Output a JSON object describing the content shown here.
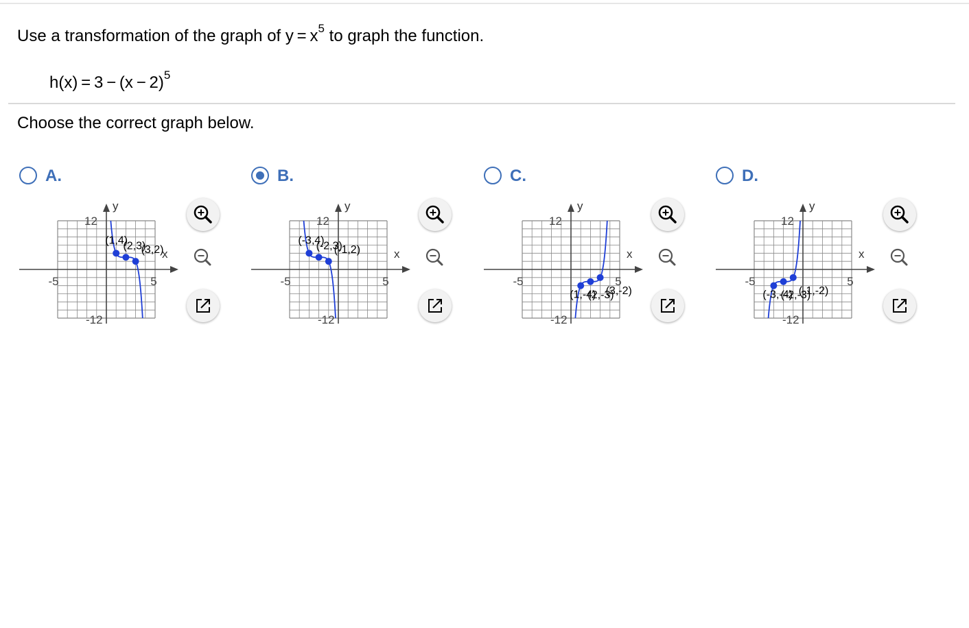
{
  "question": {
    "prefix": "Use a transformation of the graph of y = x",
    "exponent": "5",
    "suffix": " to graph the function."
  },
  "function": {
    "base": "h(x) = 3 − (x − 2)",
    "exponent": "5"
  },
  "instruction": "Choose the correct graph below.",
  "selected_option": "B",
  "colors": {
    "accent": "#3e6fb8",
    "curve": "#1f3fd6",
    "grid": "#888888"
  },
  "tools": [
    "zoom-in-icon",
    "zoom-out-icon",
    "open-in-new-window-icon"
  ],
  "chart_data": [
    {
      "type": "line",
      "option": "A.",
      "selected": false,
      "xlabel": "x",
      "ylabel": "y",
      "xlim": [
        -5,
        5
      ],
      "ylim": [
        -12,
        12
      ],
      "x_ticks": [
        "-5",
        "5"
      ],
      "y_ticks": [
        "12",
        "-12"
      ],
      "grid": true,
      "points": [
        {
          "x": 1,
          "y": 4,
          "label": "(1,4)"
        },
        {
          "x": 2,
          "y": 3,
          "label": "(2,3)"
        },
        {
          "x": 3,
          "y": 2,
          "label": "(3,2)"
        }
      ],
      "curve": {
        "h": 2,
        "k": 3,
        "a": -1
      }
    },
    {
      "type": "line",
      "option": "B.",
      "selected": true,
      "xlabel": "x",
      "ylabel": "y",
      "xlim": [
        -5,
        5
      ],
      "ylim": [
        -12,
        12
      ],
      "x_ticks": [
        "-5",
        "5"
      ],
      "y_ticks": [
        "12",
        "-12"
      ],
      "grid": true,
      "points": [
        {
          "x": -3,
          "y": 4,
          "label": "(-3,4)"
        },
        {
          "x": -2,
          "y": 3,
          "label": "(-2,3)"
        },
        {
          "x": -1,
          "y": 2,
          "label": "(-1,2)"
        }
      ],
      "curve": {
        "h": -2,
        "k": 3,
        "a": -1
      }
    },
    {
      "type": "line",
      "option": "C.",
      "selected": false,
      "xlabel": "x",
      "ylabel": "y",
      "xlim": [
        -5,
        5
      ],
      "ylim": [
        -12,
        12
      ],
      "x_ticks": [
        "-5",
        "5"
      ],
      "y_ticks": [
        "12",
        "-12"
      ],
      "grid": true,
      "points": [
        {
          "x": 1,
          "y": -4,
          "label": "(1,-4)"
        },
        {
          "x": 2,
          "y": -3,
          "label": "(2,-3)"
        },
        {
          "x": 3,
          "y": -2,
          "label": "(3,-2)"
        }
      ],
      "curve": {
        "h": 2,
        "k": -3,
        "a": 1
      }
    },
    {
      "type": "line",
      "option": "D.",
      "selected": false,
      "xlabel": "x",
      "ylabel": "y",
      "xlim": [
        -5,
        5
      ],
      "ylim": [
        -12,
        12
      ],
      "x_ticks": [
        "-5",
        "5"
      ],
      "y_ticks": [
        "12",
        "-12"
      ],
      "grid": true,
      "points": [
        {
          "x": -3,
          "y": -4,
          "label": "(-3,-4)"
        },
        {
          "x": -2,
          "y": -3,
          "label": "(-2,-3)"
        },
        {
          "x": -1,
          "y": -2,
          "label": "(-1,-2)"
        }
      ],
      "curve": {
        "h": -2,
        "k": -3,
        "a": 1
      }
    }
  ]
}
